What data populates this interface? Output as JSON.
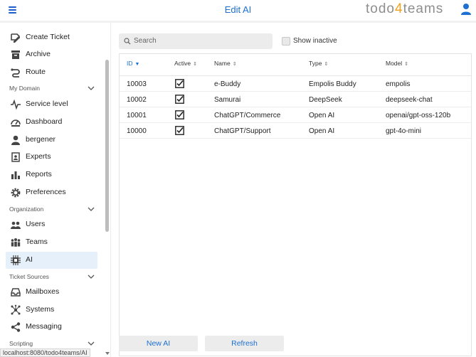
{
  "header": {
    "title": "Edit AI",
    "brand_prefix": "todo",
    "brand_digit": "4",
    "brand_suffix": "teams",
    "accent_color": "#1d6fd1",
    "brand_digit_color": "#f2a11c"
  },
  "sidebar": {
    "items_top": [
      {
        "label": "Create Ticket",
        "icon": "create-ticket-icon"
      },
      {
        "label": "Archive",
        "icon": "archive-icon"
      },
      {
        "label": "Route",
        "icon": "route-icon"
      }
    ],
    "sections": [
      {
        "label": "My Domain",
        "items": [
          {
            "label": "Service level",
            "icon": "pulse-icon"
          },
          {
            "label": "Dashboard",
            "icon": "dashboard-icon"
          },
          {
            "label": "bergener",
            "icon": "person-icon"
          },
          {
            "label": "Experts",
            "icon": "experts-icon"
          },
          {
            "label": "Reports",
            "icon": "bar-chart-icon"
          },
          {
            "label": "Preferences",
            "icon": "gear-icon"
          }
        ]
      },
      {
        "label": "Organization",
        "items": [
          {
            "label": "Users",
            "icon": "users-icon"
          },
          {
            "label": "Teams",
            "icon": "teams-icon"
          },
          {
            "label": "AI",
            "icon": "chip-icon",
            "active": true
          }
        ]
      },
      {
        "label": "Ticket Sources",
        "items": [
          {
            "label": "Mailboxes",
            "icon": "inbox-icon"
          },
          {
            "label": "Systems",
            "icon": "network-icon"
          },
          {
            "label": "Messaging",
            "icon": "share-icon"
          }
        ]
      },
      {
        "label": "Scripting",
        "items": []
      }
    ]
  },
  "toolbar": {
    "search_placeholder": "Search",
    "show_inactive_label": "Show inactive",
    "show_inactive_checked": false
  },
  "table": {
    "columns": [
      "ID",
      "Active",
      "Name",
      "Type",
      "Model"
    ],
    "sorted_column": "ID",
    "rows": [
      {
        "id": "10003",
        "active": true,
        "name": "e-Buddy",
        "type": "Empolis Buddy",
        "model": "empolis"
      },
      {
        "id": "10002",
        "active": true,
        "name": "Samurai",
        "type": "DeepSeek",
        "model": "deepseek-chat"
      },
      {
        "id": "10001",
        "active": true,
        "name": "ChatGPT/Commerce",
        "type": "Open AI",
        "model": "openai/gpt-oss-120b"
      },
      {
        "id": "10000",
        "active": true,
        "name": "ChatGPT/Support",
        "type": "Open AI",
        "model": "gpt-4o-mini"
      }
    ]
  },
  "buttons": {
    "new_label": "New AI",
    "refresh_label": "Refresh"
  },
  "status_bar": {
    "url": "localhost:8080/todo4teams/AI"
  }
}
